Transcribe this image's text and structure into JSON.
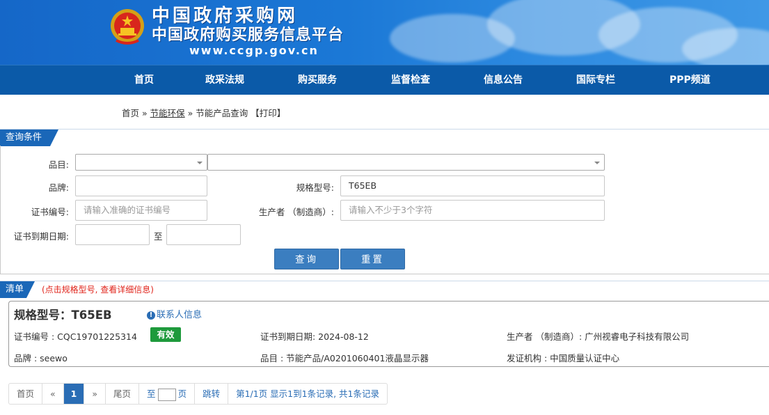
{
  "header": {
    "title": "中国政府采购网",
    "subtitle": "中国政府购买服务信息平台",
    "url": "www.ccgp.gov.cn"
  },
  "nav": {
    "items": [
      "首页",
      "政采法规",
      "购买服务",
      "监督检查",
      "信息公告",
      "国际专栏",
      "PPP频道"
    ]
  },
  "breadcrumb": {
    "home": "首页",
    "sep1": "»",
    "section": "节能环保",
    "sep2": "»",
    "current": "节能产品查询",
    "print": "【打印】"
  },
  "query": {
    "panel_title": "查询条件",
    "category_label": "品目:",
    "brand_label": "品牌:",
    "model_label": "规格型号:",
    "model_value": "T65EB",
    "cert_label": "证书编号:",
    "cert_placeholder": "请输入准确的证书编号",
    "maker_label": "生产者 （制造商）:",
    "maker_placeholder": "请输入不少于3个字符",
    "expiry_label": "证书到期日期:",
    "date_to": "至",
    "search_button": "查询",
    "reset_button": "重置"
  },
  "list": {
    "title": "清单",
    "hint": "(点击规格型号, 查看详细信息)",
    "card": {
      "title": "规格型号：T65EB",
      "contact_link": "联系人信息",
      "cert_no": "证书编号 : CQC19701225314",
      "status": "有效",
      "expiry": "证书到期日期: 2024-08-12",
      "maker": "生产者 （制造商）: 广州视睿电子科技有限公司",
      "brand": "品牌 : seewo",
      "category": "品目 : 节能产品/A0201060401液晶显示器",
      "issuer": "发证机构 : 中国质量认证中心"
    }
  },
  "pagination": {
    "first": "首页",
    "prev": "«",
    "current": "1",
    "next": "»",
    "last": "尾页",
    "goto_prefix": "至",
    "goto_suffix": "页",
    "jump": "跳转",
    "summary": "第1/1页  显示1到1条记录, 共1条记录"
  },
  "colors": {
    "nav_bg": "#0b5aa8",
    "accent": "#1a67b8",
    "button": "#3b7ec0",
    "valid_badge": "#1e9a3c",
    "hint_red": "#e0241b"
  }
}
